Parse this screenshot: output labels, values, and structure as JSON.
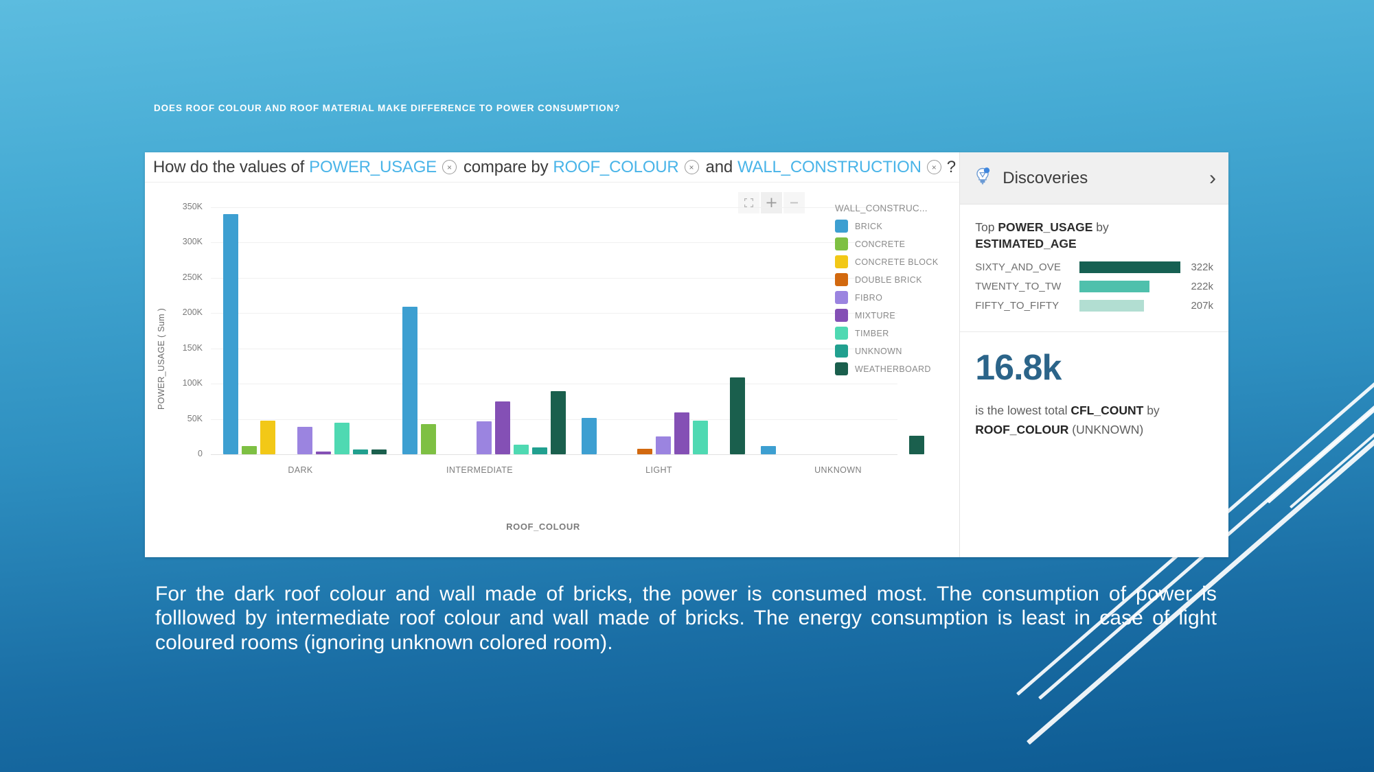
{
  "slide": {
    "title": "DOES ROOF COLOUR AND ROOF MATERIAL MAKE DIFFERENCE TO POWER CONSUMPTION?",
    "caption": "For the dark roof colour and wall made of bricks, the power is consumed most. The consumption of power is folllowed by intermediate roof colour and wall made of bricks. The energy consumption is least in case of light coloured rooms (ignoring unknown colored room).",
    "background_top_color": "#5cbcdf",
    "background_bottom_color": "#0d5a92"
  },
  "question_bar": {
    "prefix": "How do the values of",
    "measure": "POWER_USAGE",
    "middle": "compare by",
    "dimension_1": "ROOF_COLOUR",
    "conjunction": "and",
    "dimension_2": "WALL_CONSTRUCTION",
    "suffix": "?",
    "remove_icon": "×",
    "field_color": "#49b4e8"
  },
  "chart_tools": [
    {
      "name": "fullscreen-button",
      "glyph": "⛶"
    },
    {
      "name": "zoom-in-button",
      "glyph": "+"
    },
    {
      "name": "zoom-out-button",
      "glyph": "−"
    }
  ],
  "chart_data": {
    "type": "bar",
    "title": "",
    "xlabel": "ROOF_COLOUR",
    "ylabel": "POWER_USAGE ( Sum )",
    "ylim": [
      0,
      350000
    ],
    "ytick_labels": [
      "350K",
      "300K",
      "250K",
      "200K",
      "150K",
      "100K",
      "50K",
      "0"
    ],
    "ytick_values": [
      350000,
      300000,
      250000,
      200000,
      150000,
      100000,
      50000,
      0
    ],
    "grid": true,
    "legend_position": "right",
    "legend_title": "WALL_CONSTRUC...",
    "categories": [
      "DARK",
      "INTERMEDIATE",
      "LIGHT",
      "UNKNOWN"
    ],
    "series": [
      {
        "name": "BRICK",
        "color": "#3d9fd1",
        "values": [
          340000,
          209000,
          52000,
          12000
        ]
      },
      {
        "name": "CONCRETE",
        "color": "#7ec043",
        "values": [
          12000,
          43000,
          0,
          0
        ]
      },
      {
        "name": "CONCRETE BLOCK",
        "color": "#f2c817",
        "values": [
          48000,
          0,
          0,
          0
        ]
      },
      {
        "name": "DOUBLE BRICK",
        "color": "#d2690f",
        "values": [
          0,
          0,
          8000,
          0
        ]
      },
      {
        "name": "FIBRO",
        "color": "#9b84e0",
        "values": [
          39000,
          47000,
          25000,
          0
        ]
      },
      {
        "name": "MIXTURE",
        "color": "#8450b5",
        "values": [
          4000,
          75000,
          59000,
          0
        ]
      },
      {
        "name": "TIMBER",
        "color": "#4fd9b2",
        "values": [
          45000,
          14000,
          48000,
          0
        ]
      },
      {
        "name": "UNKNOWN",
        "color": "#21a08f",
        "values": [
          7000,
          10000,
          0,
          0
        ]
      },
      {
        "name": "WEATHERBOARD",
        "color": "#1a5f4d",
        "values": [
          7000,
          89000,
          109000,
          26000
        ]
      }
    ]
  },
  "discoveries": {
    "header_title": "Discoveries",
    "bulb_icon": "lightbulb-icon",
    "chevron_icon": "›",
    "top_block": {
      "heading_prefix": "Top",
      "heading_measure": "POWER_USAGE",
      "heading_by": "by",
      "heading_dimension": "ESTIMATED_AGE",
      "rows": [
        {
          "label": "SIXTY_AND_OVE",
          "value": "322k",
          "bar_pct": 100,
          "color": "#166052"
        },
        {
          "label": "TWENTY_TO_TW",
          "value": "222k",
          "bar_pct": 69,
          "color": "#4fc0ac"
        },
        {
          "label": "FIFTY_TO_FIFTY",
          "value": "207k",
          "bar_pct": 64,
          "color": "#b2ded2"
        }
      ]
    },
    "bottom_block": {
      "big_value": "16.8k",
      "text_1": "is the lowest total",
      "metric": "CFL_COUNT",
      "text_2": "by",
      "dimension": "ROOF_COLOUR",
      "qualifier": "(UNKNOWN)",
      "big_value_color": "#2b6489"
    }
  }
}
